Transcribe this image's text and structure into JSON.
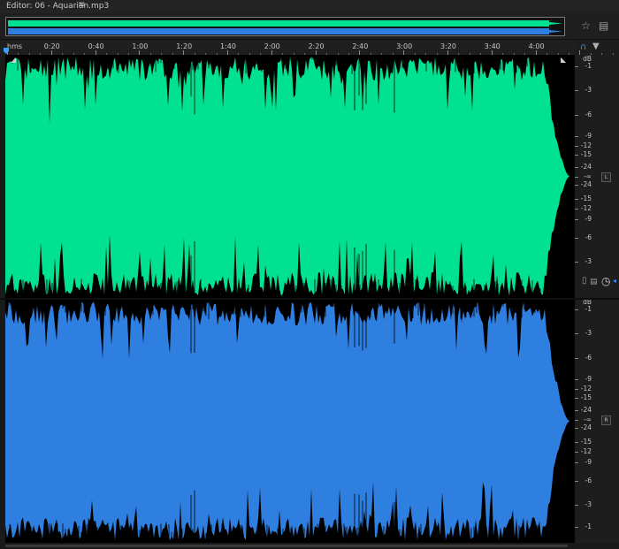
{
  "editor": {
    "title": "Editor: 06 - Aquarian.mp3",
    "menu_icon": "hamburger-icon"
  },
  "overview": {
    "top_channel_color": "#00e191",
    "bottom_channel_color": "#2f7fe0"
  },
  "ruler": {
    "unit": "hms",
    "labels": [
      "0:20",
      "0:40",
      "1:00",
      "1:20",
      "1:40",
      "2:00",
      "2:20",
      "2:40",
      "3:00",
      "3:20",
      "3:40",
      "4:00"
    ]
  },
  "channels": [
    {
      "id": "L",
      "badge": "L",
      "color": "#00e191"
    },
    {
      "id": "R",
      "badge": "R",
      "color": "#2f7fe0"
    }
  ],
  "db_scale": {
    "unit": "dB",
    "top_labels": [
      "-1",
      "-3",
      "-6",
      "-9",
      "-12",
      "-15",
      "-24"
    ],
    "center": "-∞",
    "bottom_labels": [
      "-24",
      "-15",
      "-12",
      "-9",
      "-6",
      "-3"
    ],
    "end_label": "-1"
  },
  "icons": {
    "zoom": "magnet-icon",
    "pin": "pin-icon",
    "volume": "volume-knob-icon",
    "meter": "level-meter-icon",
    "expand": "expand-corner-icon",
    "star": "star-icon",
    "panel": "panel-toggle-icon"
  }
}
